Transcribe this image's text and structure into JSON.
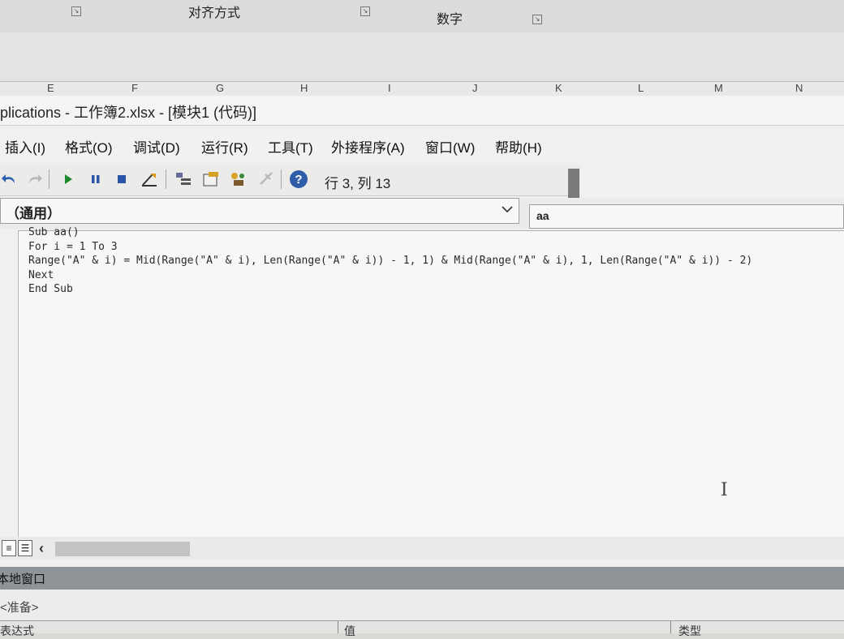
{
  "ribbon": {
    "groups": [
      "对齐方式",
      "数字"
    ],
    "columns": [
      "E",
      "F",
      "G",
      "H",
      "I",
      "J",
      "K",
      "L",
      "M",
      "N"
    ]
  },
  "window": {
    "title": "plications - 工作簿2.xlsx - [模块1 (代码)]"
  },
  "menu": {
    "items": [
      "插入(I)",
      "格式(O)",
      "调试(D)",
      "运行(R)",
      "工具(T)",
      "外接程序(A)",
      "窗口(W)",
      "帮助(H)"
    ]
  },
  "toolbar": {
    "icons": [
      "undo-icon",
      "redo-icon",
      "run-icon",
      "break-icon",
      "reset-icon",
      "design-mode-icon",
      "project-explorer-icon",
      "properties-icon",
      "object-browser-icon",
      "toolbox-icon",
      "help-icon"
    ],
    "position_text": "行 3, 列 13"
  },
  "combos": {
    "object": "（通用）",
    "procedure": "aa"
  },
  "code": {
    "lines": [
      "Sub aa()",
      "For i = 1 To 3",
      "Range(\"A\" & i) = Mid(Range(\"A\" & i), Len(Range(\"A\" & i)) - 1, 1) & Mid(Range(\"A\" & i), 1, Len(Range(\"A\" & i)) - 2)",
      "Next",
      "End Sub"
    ]
  },
  "locals": {
    "title": "本地窗口",
    "status": "<准备>",
    "headers": [
      "表达式",
      "值",
      "类型"
    ]
  },
  "colors": {
    "locals_title_bg": "#8f9498",
    "code_bg": "#f7f7f5",
    "help_icon": "#2f5da8"
  }
}
